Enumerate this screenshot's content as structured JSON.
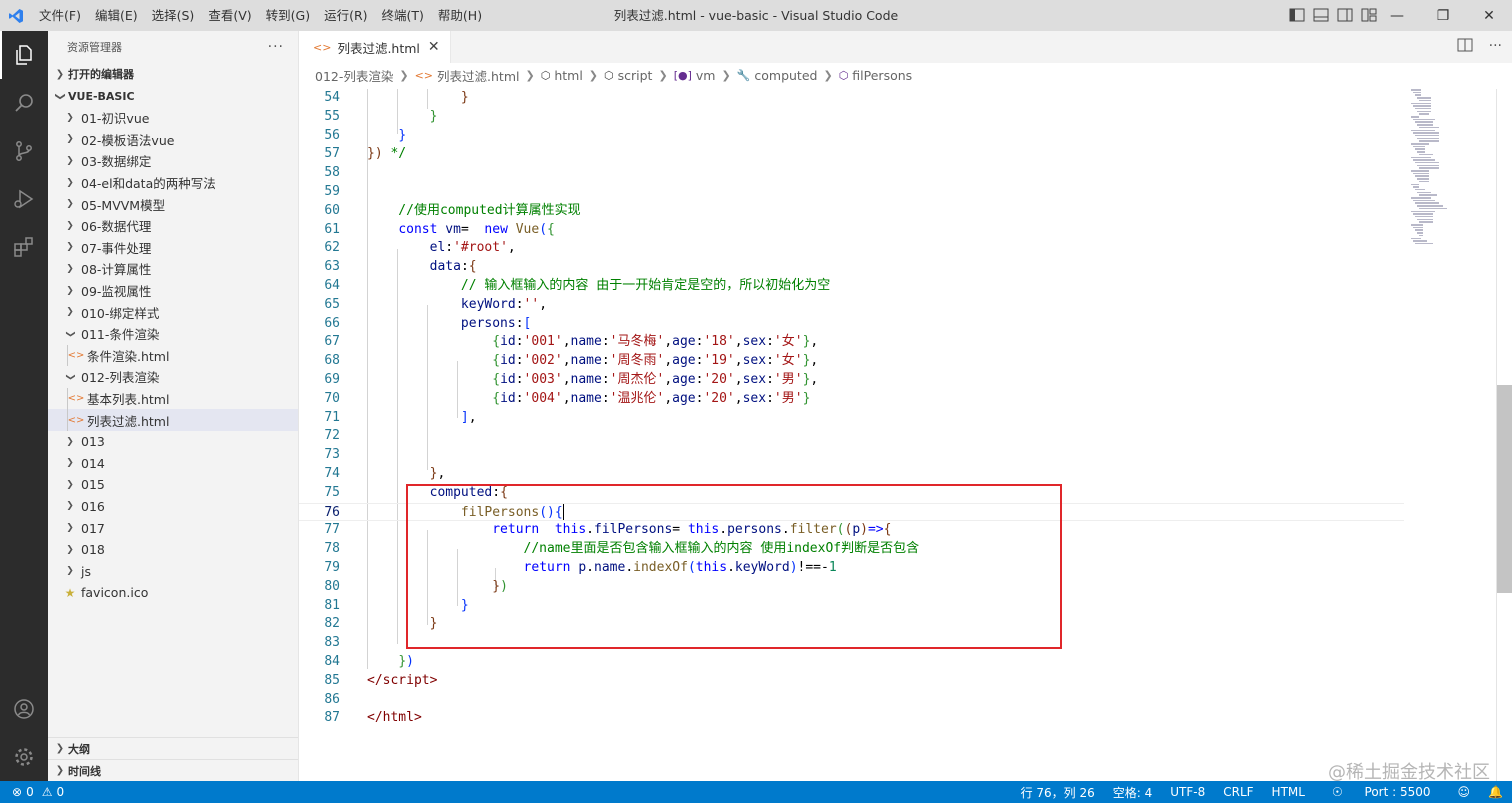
{
  "window": {
    "title": "列表过滤.html - vue-basic - Visual Studio Code",
    "menu": [
      "文件(F)",
      "编辑(E)",
      "选择(S)",
      "查看(V)",
      "转到(G)",
      "运行(R)",
      "终端(T)",
      "帮助(H)"
    ]
  },
  "sidebar": {
    "header": "资源管理器",
    "open_editors": "打开的编辑器",
    "root": "VUE-BASIC",
    "items": [
      {
        "label": "01-初识vue",
        "type": "folder"
      },
      {
        "label": "02-模板语法vue",
        "type": "folder"
      },
      {
        "label": "03-数据绑定",
        "type": "folder"
      },
      {
        "label": "04-el和data的两种写法",
        "type": "folder"
      },
      {
        "label": "05-MVVM模型",
        "type": "folder"
      },
      {
        "label": "06-数据代理",
        "type": "folder"
      },
      {
        "label": "07-事件处理",
        "type": "folder"
      },
      {
        "label": "08-计算属性",
        "type": "folder"
      },
      {
        "label": "09-监视属性",
        "type": "folder"
      },
      {
        "label": "010-绑定样式",
        "type": "folder"
      },
      {
        "label": "011-条件渲染",
        "type": "folder-open"
      },
      {
        "label": "条件渲染.html",
        "type": "html"
      },
      {
        "label": "012-列表渲染",
        "type": "folder-open"
      },
      {
        "label": "基本列表.html",
        "type": "html"
      },
      {
        "label": "列表过滤.html",
        "type": "html"
      },
      {
        "label": "013",
        "type": "folder"
      },
      {
        "label": "014",
        "type": "folder"
      },
      {
        "label": "015",
        "type": "folder"
      },
      {
        "label": "016",
        "type": "folder"
      },
      {
        "label": "017",
        "type": "folder"
      },
      {
        "label": "018",
        "type": "folder"
      },
      {
        "label": "js",
        "type": "folder"
      },
      {
        "label": "favicon.ico",
        "type": "ico"
      }
    ],
    "outline": "大纲",
    "timeline": "时间线"
  },
  "editor": {
    "tab_label": "列表过滤.html",
    "breadcrumb": [
      "012-列表渲染",
      "列表过滤.html",
      "html",
      "script",
      "vm",
      "computed",
      "filPersons"
    ]
  },
  "status": {
    "errors": "0",
    "warnings": "0",
    "position": "行 76，列 26",
    "spaces": "空格: 4",
    "encoding": "UTF-8",
    "eol": "CRLF",
    "language": "HTML",
    "port": "Port : 5500"
  },
  "watermark": "@稀土掘金技术社区",
  "colors": {
    "accent": "#007acc",
    "highlight_box": "#e0262a"
  }
}
